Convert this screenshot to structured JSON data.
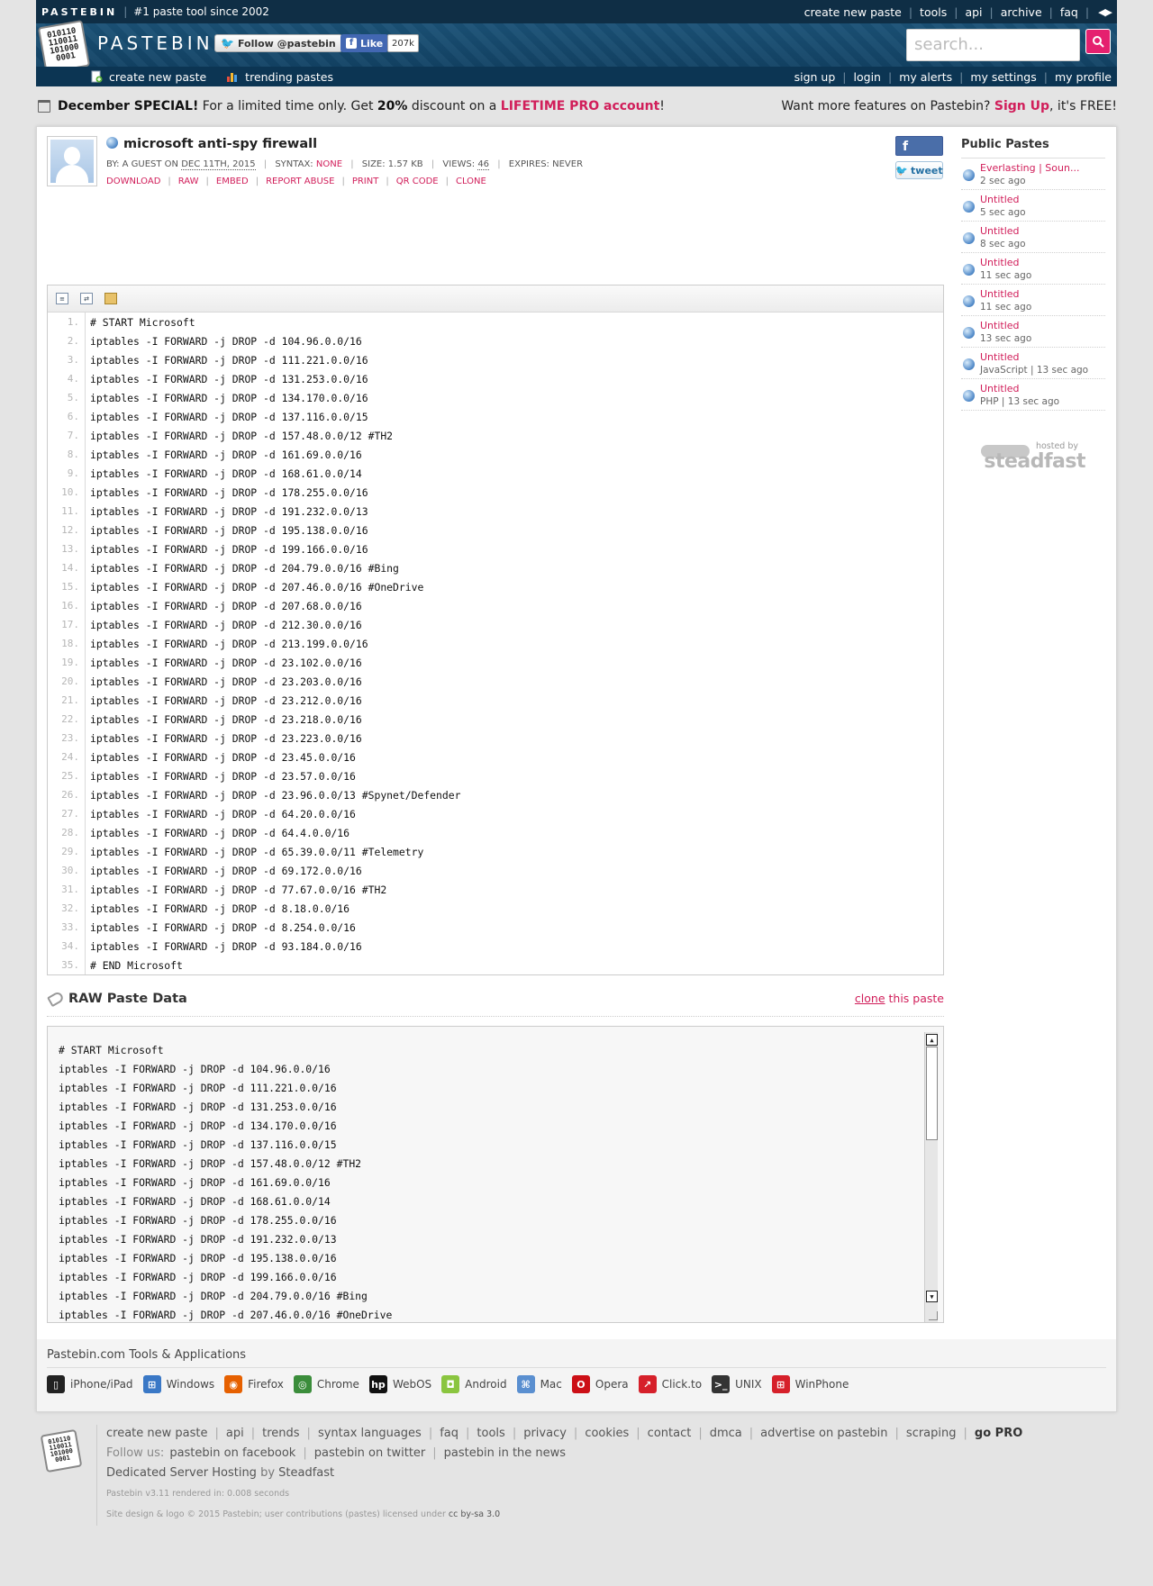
{
  "topbar": {
    "brand": "PASTEBIN",
    "tagline": "#1 paste tool since 2002",
    "links": [
      "create new paste",
      "tools",
      "api",
      "archive",
      "faq"
    ]
  },
  "header": {
    "logo_text": "PASTEBIN",
    "logo_digits": "010110 110011 101000 0001",
    "follow_label": "Follow @pastebin",
    "like_label": "Like",
    "like_count": "207k",
    "search_placeholder": "search..."
  },
  "nav": {
    "create": "create new paste",
    "trending": "trending pastes",
    "user_links": [
      "sign up",
      "login",
      "my alerts",
      "my settings",
      "my profile"
    ]
  },
  "promo": {
    "bold": "December SPECIAL!",
    "text1": " For a limited time only. Get ",
    "discount": "20%",
    "text2": " discount on a ",
    "pro_link": "LIFETIME PRO account",
    "text3": "!",
    "right_text1": "Want more features on Pastebin? ",
    "signup": "Sign Up",
    "right_text2": ", it's FREE!"
  },
  "paste": {
    "title": "microsoft anti-spy firewall",
    "by": "BY: A GUEST ON",
    "date": "DEC 11TH, 2015",
    "syntax_label": "SYNTAX:",
    "syntax": "NONE",
    "size": "SIZE: 1.57 KB",
    "views_label": "VIEWS:",
    "views": "46",
    "expires": "EXPIRES: NEVER",
    "actions": [
      "DOWNLOAD",
      "RAW",
      "EMBED",
      "REPORT ABUSE",
      "PRINT",
      "QR CODE",
      "CLONE"
    ],
    "tweet": "tweet",
    "fb": "f"
  },
  "code": [
    "# START Microsoft",
    "iptables -I FORWARD -j DROP -d 104.96.0.0/16",
    "iptables -I FORWARD -j DROP -d 111.221.0.0/16",
    "iptables -I FORWARD -j DROP -d 131.253.0.0/16",
    "iptables -I FORWARD -j DROP -d 134.170.0.0/16",
    "iptables -I FORWARD -j DROP -d 137.116.0.0/15",
    "iptables -I FORWARD -j DROP -d 157.48.0.0/12 #TH2",
    "iptables -I FORWARD -j DROP -d 161.69.0.0/16",
    "iptables -I FORWARD -j DROP -d 168.61.0.0/14",
    "iptables -I FORWARD -j DROP -d 178.255.0.0/16",
    "iptables -I FORWARD -j DROP -d 191.232.0.0/13",
    "iptables -I FORWARD -j DROP -d 195.138.0.0/16",
    "iptables -I FORWARD -j DROP -d 199.166.0.0/16",
    "iptables -I FORWARD -j DROP -d 204.79.0.0/16 #Bing",
    "iptables -I FORWARD -j DROP -d 207.46.0.0/16 #OneDrive",
    "iptables -I FORWARD -j DROP -d 207.68.0.0/16",
    "iptables -I FORWARD -j DROP -d 212.30.0.0/16",
    "iptables -I FORWARD -j DROP -d 213.199.0.0/16",
    "iptables -I FORWARD -j DROP -d 23.102.0.0/16",
    "iptables -I FORWARD -j DROP -d 23.203.0.0/16",
    "iptables -I FORWARD -j DROP -d 23.212.0.0/16",
    "iptables -I FORWARD -j DROP -d 23.218.0.0/16",
    "iptables -I FORWARD -j DROP -d 23.223.0.0/16",
    "iptables -I FORWARD -j DROP -d 23.45.0.0/16",
    "iptables -I FORWARD -j DROP -d 23.57.0.0/16",
    "iptables -I FORWARD -j DROP -d 23.96.0.0/13 #Spynet/Defender",
    "iptables -I FORWARD -j DROP -d 64.20.0.0/16",
    "iptables -I FORWARD -j DROP -d 64.4.0.0/16",
    "iptables -I FORWARD -j DROP -d 65.39.0.0/11 #Telemetry",
    "iptables -I FORWARD -j DROP -d 69.172.0.0/16",
    "iptables -I FORWARD -j DROP -d 77.67.0.0/16 #TH2",
    "iptables -I FORWARD -j DROP -d 8.18.0.0/16",
    "iptables -I FORWARD -j DROP -d 8.254.0.0/16",
    "iptables -I FORWARD -j DROP -d 93.184.0.0/16",
    "# END Microsoft"
  ],
  "raw": {
    "title": "RAW Paste Data",
    "clone_link": "clone",
    "clone_rest": " this paste",
    "lines": [
      "# START Microsoft",
      "iptables -I FORWARD -j DROP -d 104.96.0.0/16",
      "iptables -I FORWARD -j DROP -d 111.221.0.0/16",
      "iptables -I FORWARD -j DROP -d 131.253.0.0/16",
      "iptables -I FORWARD -j DROP -d 134.170.0.0/16",
      "iptables -I FORWARD -j DROP -d 137.116.0.0/15",
      "iptables -I FORWARD -j DROP -d 157.48.0.0/12 #TH2",
      "iptables -I FORWARD -j DROP -d 161.69.0.0/16",
      "iptables -I FORWARD -j DROP -d 168.61.0.0/14",
      "iptables -I FORWARD -j DROP -d 178.255.0.0/16",
      "iptables -I FORWARD -j DROP -d 191.232.0.0/13",
      "iptables -I FORWARD -j DROP -d 195.138.0.0/16",
      "iptables -I FORWARD -j DROP -d 199.166.0.0/16",
      "iptables -I FORWARD -j DROP -d 204.79.0.0/16 #Bing",
      "iptables -I FORWARD -j DROP -d 207.46.0.0/16 #OneDrive"
    ]
  },
  "sidebar": {
    "title": "Public Pastes",
    "items": [
      {
        "title": "Everlasting | Soun...",
        "meta": "2 sec ago"
      },
      {
        "title": "Untitled",
        "meta": "5 sec ago"
      },
      {
        "title": "Untitled",
        "meta": "8 sec ago"
      },
      {
        "title": "Untitled",
        "meta": "11 sec ago"
      },
      {
        "title": "Untitled",
        "meta": "11 sec ago"
      },
      {
        "title": "Untitled",
        "meta": "13 sec ago"
      },
      {
        "title": "Untitled",
        "meta": "JavaScript | 13 sec ago"
      },
      {
        "title": "Untitled",
        "meta": "PHP | 13 sec ago"
      }
    ],
    "hosted_by": "hosted by",
    "host": "steadfast"
  },
  "tools": {
    "title": "Pastebin.com Tools & Applications",
    "apps": [
      {
        "name": "iPhone/iPad",
        "icon": "phone-icon",
        "color": "#222222"
      },
      {
        "name": "Windows",
        "icon": "windows-icon",
        "color": "#3a78c6"
      },
      {
        "name": "Firefox",
        "icon": "firefox-icon",
        "color": "#e66000"
      },
      {
        "name": "Chrome",
        "icon": "chrome-icon",
        "color": "#3b8d3b"
      },
      {
        "name": "WebOS",
        "icon": "hp-icon",
        "color": "#111111"
      },
      {
        "name": "Android",
        "icon": "android-icon",
        "color": "#8ac53f"
      },
      {
        "name": "Mac",
        "icon": "mac-icon",
        "color": "#5a8fd0"
      },
      {
        "name": "Opera",
        "icon": "opera-icon",
        "color": "#cc0f16"
      },
      {
        "name": "Click.to",
        "icon": "clickto-icon",
        "color": "#d6202a"
      },
      {
        "name": "UNIX",
        "icon": "terminal-icon",
        "color": "#333333"
      },
      {
        "name": "WinPhone",
        "icon": "winphone-icon",
        "color": "#d6202a"
      }
    ]
  },
  "footer": {
    "links": [
      "create new paste",
      "api",
      "trends",
      "syntax languages",
      "faq",
      "tools",
      "privacy",
      "cookies",
      "contact",
      "dmca",
      "advertise on pastebin",
      "scraping"
    ],
    "gopro": "go PRO",
    "follow_label": "Follow us:",
    "follow_links": [
      "pastebin on facebook",
      "pastebin on twitter",
      "pastebin in the news"
    ],
    "hosting_link": "Dedicated Server Hosting",
    "hosting_by": " by ",
    "hosting_host": "Steadfast",
    "version": "Pastebin v3.11 rendered in: 0.008 seconds",
    "copyright": "Site design & logo © 2015 Pastebin; user contributions (pastes) licensed under ",
    "license": "cc by-sa 3.0"
  },
  "colors": {
    "header_bg": "#0c3b5b",
    "accent": "#d11e5a",
    "search_btn": "#e5206f"
  }
}
